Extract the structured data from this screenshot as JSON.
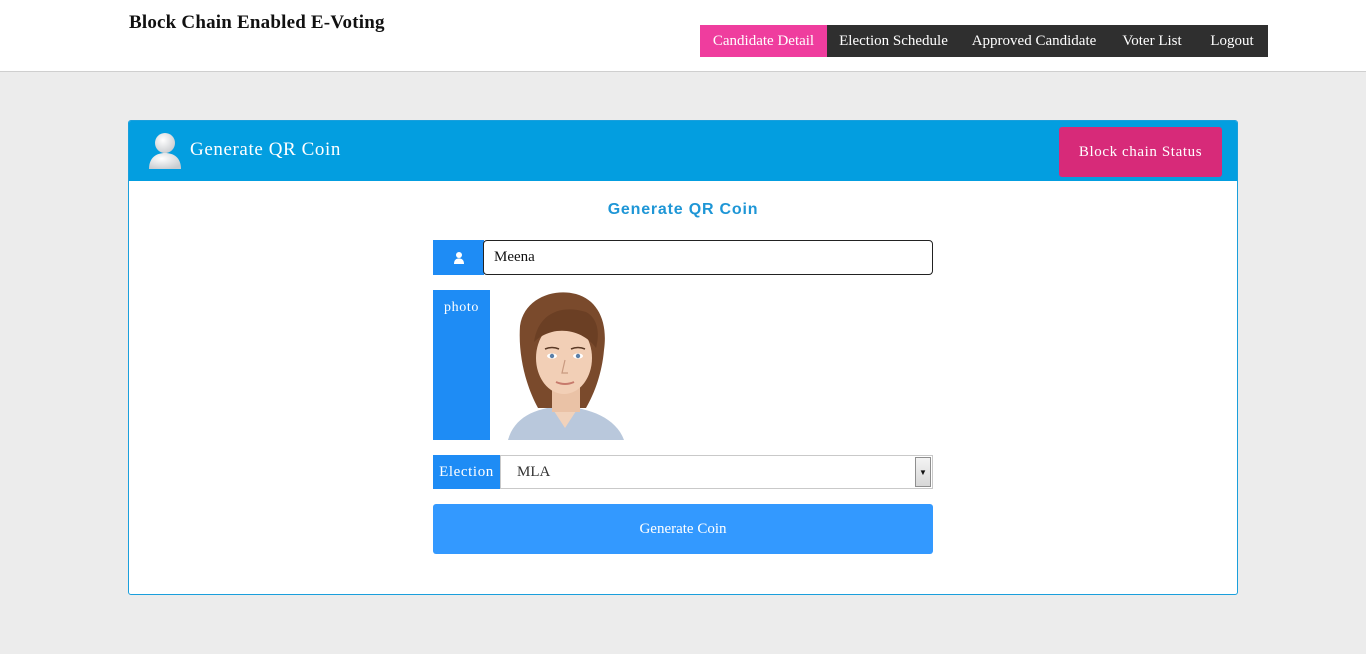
{
  "app": {
    "title": "Block Chain Enabled E-Voting"
  },
  "nav": {
    "items": [
      {
        "label": "Candidate Detail",
        "active": true
      },
      {
        "label": "Election Schedule",
        "active": false
      },
      {
        "label": "Approved Candidate",
        "active": false
      },
      {
        "label": "Voter List",
        "active": false
      },
      {
        "label": "Logout",
        "active": false
      }
    ]
  },
  "panel": {
    "heading": "Generate QR Coin",
    "blockchain_button": "Block chain Status"
  },
  "form": {
    "title": "Generate QR Coin",
    "name_value": "Meena",
    "photo_label": "photo",
    "election_label": "Election",
    "election_value": "MLA",
    "submit_label": "Generate Coin"
  },
  "colors": {
    "nav_active": "#ef3d9e",
    "nav_bg": "#2f2f2f",
    "panel_header": "#039ee0",
    "blockchain_button": "#d72a79",
    "addon": "#1e8cf5",
    "submit": "#3399ff"
  },
  "icons": {
    "header": "user-avatar-icon",
    "name_addon": "user-icon",
    "select": "dropdown-arrow-icon"
  }
}
